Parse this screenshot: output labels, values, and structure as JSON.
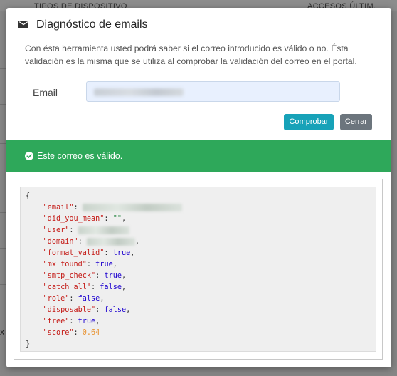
{
  "background": {
    "header_col1": "TIPOS DE DISPOSITIVO",
    "header_col2": "ACCESOS ÚLTIM. SEM.",
    "left_x": "x"
  },
  "modal": {
    "icon": "envelope-icon",
    "title": "Diagnóstico de emails",
    "description": "Con ésta herramienta usted podrá saber si el correo introducido es válido o no. Ésta validación es la misma que se utiliza al comprobar la validación del correo en el portal.",
    "email_label": "Email",
    "email_value": "",
    "buttons": {
      "check_label": "Comprobar",
      "close_label": "Cerrar"
    },
    "alert": {
      "icon": "check-circle-icon",
      "text": "Este correo es válido.",
      "color": "#2ea85a"
    }
  },
  "result": {
    "open_brace": "{",
    "close_brace": "}",
    "fields": [
      {
        "key": "\"email\"",
        "value": "",
        "type": "redacted"
      },
      {
        "key": "\"did_you_mean\"",
        "value": "\"\"",
        "type": "string"
      },
      {
        "key": "\"user\"",
        "value": "",
        "type": "redacted"
      },
      {
        "key": "\"domain\"",
        "value": "",
        "type": "redacted"
      },
      {
        "key": "\"format_valid\"",
        "value": "true",
        "type": "bool"
      },
      {
        "key": "\"mx_found\"",
        "value": "true",
        "type": "bool"
      },
      {
        "key": "\"smtp_check\"",
        "value": "true",
        "type": "bool"
      },
      {
        "key": "\"catch_all\"",
        "value": "false",
        "type": "bool"
      },
      {
        "key": "\"role\"",
        "value": "false",
        "type": "bool"
      },
      {
        "key": "\"disposable\"",
        "value": "false",
        "type": "bool"
      },
      {
        "key": "\"free\"",
        "value": "true",
        "type": "bool"
      },
      {
        "key": "\"score\"",
        "value": "0.64",
        "type": "number"
      }
    ]
  },
  "colors": {
    "primary_button": "#17a2b8",
    "secondary_button": "#6c757d",
    "json_key": "#c41a16",
    "json_bool": "#1c00cf",
    "json_number": "#e8912d",
    "json_string": "#1a7f37"
  }
}
